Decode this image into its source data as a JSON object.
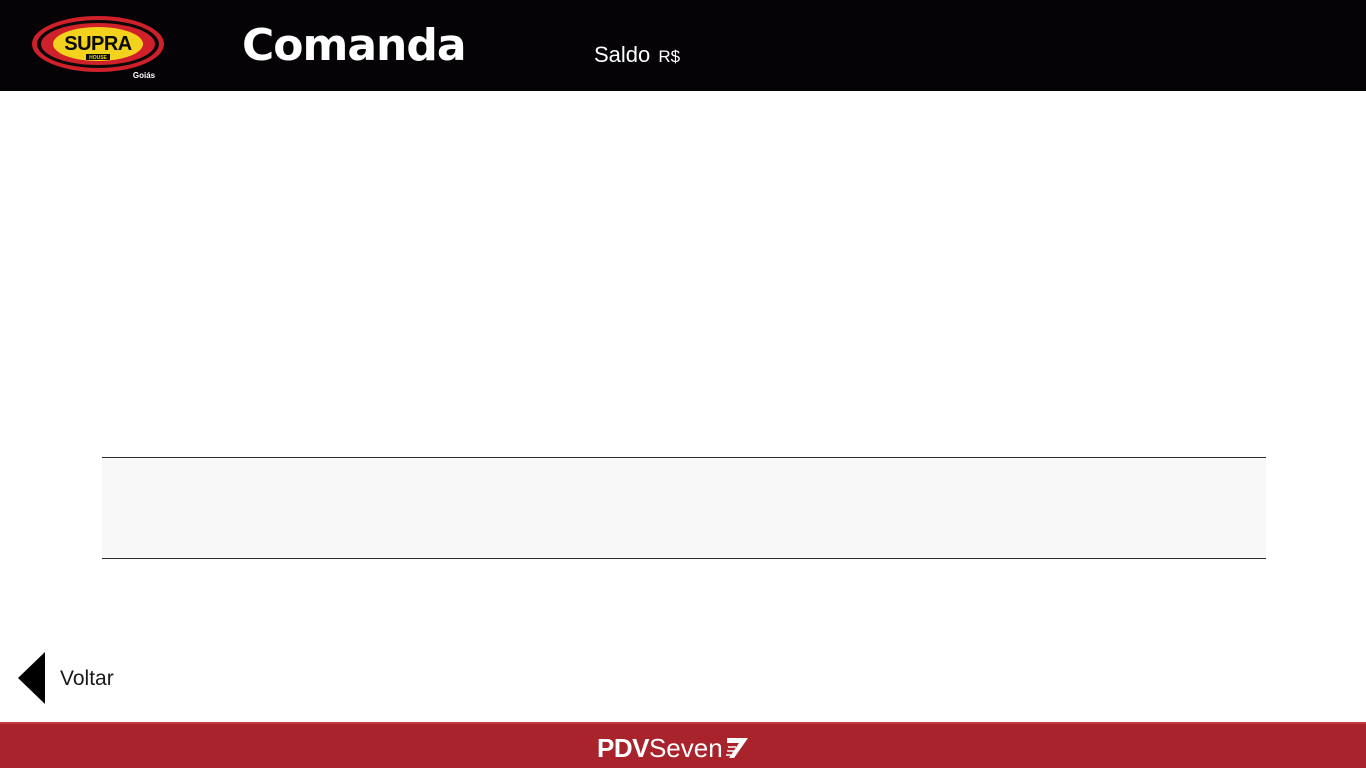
{
  "header": {
    "logo": {
      "brand": "SUPRA",
      "sub": "HOUSE",
      "region": "Goiás",
      "icon": "supra-house-logo"
    },
    "title": "Comanda",
    "balance_label": "Saldo",
    "balance_currency": "R$"
  },
  "nav": {
    "back_label": "Voltar",
    "back_icon": "triangle-left-icon"
  },
  "footer": {
    "brand_pdv": "PDV",
    "brand_seven": "Seven",
    "brand_icon": "seven-stripes-icon"
  },
  "colors": {
    "header_bg": "#050306",
    "footer_bg": "#a8232b",
    "logo_red": "#d0202a",
    "logo_yellow": "#f2d21c"
  }
}
